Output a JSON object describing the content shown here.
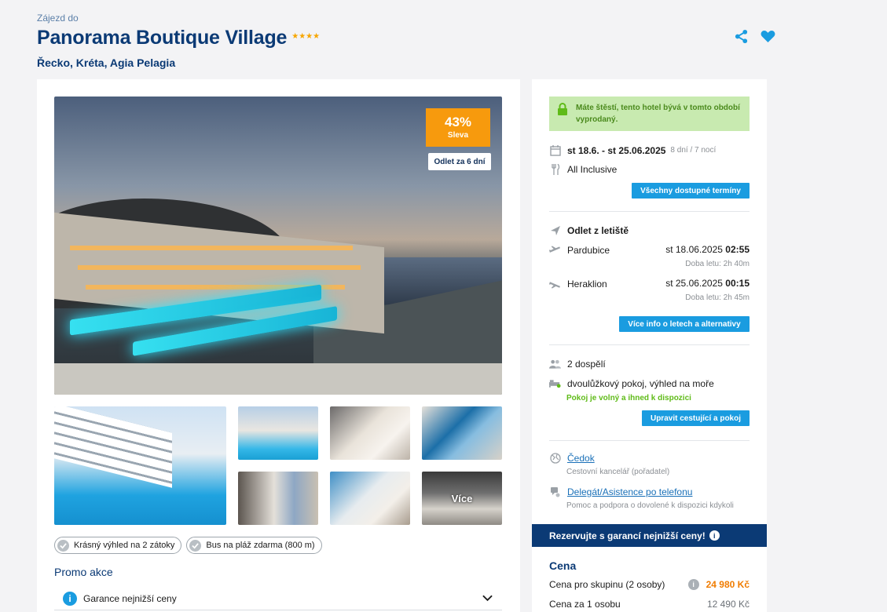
{
  "header": {
    "eyebrow": "Zájezd do",
    "title": "Panorama Boutique Village",
    "stars": "★★★★",
    "location": "Řecko, Kréta, Agia Pelagia"
  },
  "gallery": {
    "discount_pct": "43%",
    "discount_label": "Sleva",
    "departure_tag": "Odlet za 6 dní",
    "more_label": "Více"
  },
  "features": [
    "Krásný výhled na 2 zátoky",
    "Bus na pláž zdarma (800 m)"
  ],
  "promo": {
    "title": "Promo akce",
    "item": "Garance nejnižší ceny"
  },
  "sidebar": {
    "sold_out_msg": "Máte štěstí, tento hotel bývá v tomto období vyprodaný.",
    "dates": "st 18.6. - st 25.06.2025",
    "duration": "8 dní / 7 nocí",
    "board": "All Inclusive",
    "all_dates_btn": "Všechny dostupné termíny",
    "departure_title": "Odlet z letiště",
    "flight_out": {
      "airport": "Pardubice",
      "date": "st 18.06.2025",
      "time": "02:55",
      "duration": "Doba letu: 2h 40m"
    },
    "flight_back": {
      "airport": "Heraklion",
      "date": "st 25.06.2025",
      "time": "00:15",
      "duration": "Doba letu: 2h 45m"
    },
    "flights_btn": "Více info o letech a alternativy",
    "travelers": "2 dospělí",
    "room": "dvoulůžkový pokoj, výhled na moře",
    "room_status": "Pokoj je volný a ihned k dispozici",
    "edit_btn": "Upravit cestující a pokoj",
    "agency_link": "Čedok",
    "agency_desc": "Cestovní kancelář (pořadatel)",
    "support_link": "Delegát/Asistence po telefonu",
    "support_desc": "Pomoc a podpora o dovolené k dispozici kdykoli",
    "banner": "Rezervujte s garancí nejnižší ceny!",
    "price_title": "Cena",
    "price_group_label": "Cena pro skupinu (2 osoby)",
    "price_group_value": "24 980 Kč",
    "price_person_label": "Cena za 1 osobu",
    "price_person_value": "12 490 Kč"
  },
  "colors": {
    "brand": "#0b3a75",
    "accent": "#1a9ce0",
    "discount": "#f79a0d",
    "success": "#5fbb18"
  },
  "icons": [
    "share-icon",
    "heart-icon",
    "lock-icon",
    "calendar-icon",
    "cutlery-icon",
    "plane-departure-icon",
    "plane-arrival-icon",
    "people-icon",
    "bed-icon",
    "globe-icon",
    "headset-icon",
    "info-icon",
    "chevron-down-icon",
    "check-icon"
  ]
}
